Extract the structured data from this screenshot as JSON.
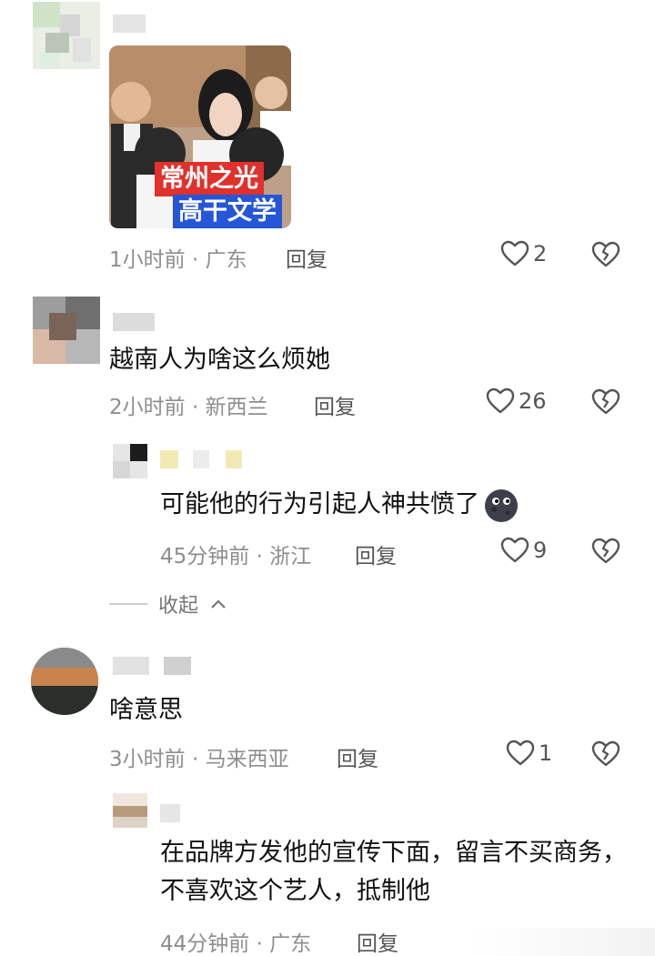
{
  "comments": [
    {
      "image_caption_line1": "常州之光",
      "image_caption_line2": "高干文学",
      "meta": "1小时前 · 广东",
      "reply": "回复",
      "likes": "2"
    },
    {
      "text": "越南人为啥这么烦她",
      "meta": "2小时前 · 新西兰",
      "reply": "回复",
      "likes": "26"
    },
    {
      "text": "可能他的行为引起人神共愤了",
      "emoji": "moon-face-emoji",
      "meta": "45分钟前 · 浙江",
      "reply": "回复",
      "likes": "9"
    },
    {
      "text": "啥意思",
      "meta": "3小时前 · 马来西亚",
      "reply": "回复",
      "likes": "1"
    },
    {
      "text": "在品牌方发他的宣传下面，留言不买商务，不喜欢这个艺人，抵制他",
      "meta": "44分钟前 · 广东",
      "reply": "回复"
    }
  ],
  "collapse_label": "收起",
  "colors": {
    "meta": "#8e8e8e",
    "text": "#111111",
    "caption_red": "#e0312c",
    "caption_blue": "#2656d8"
  },
  "icons": [
    "heart-outline-icon",
    "broken-heart-icon",
    "chevron-up-icon"
  ]
}
